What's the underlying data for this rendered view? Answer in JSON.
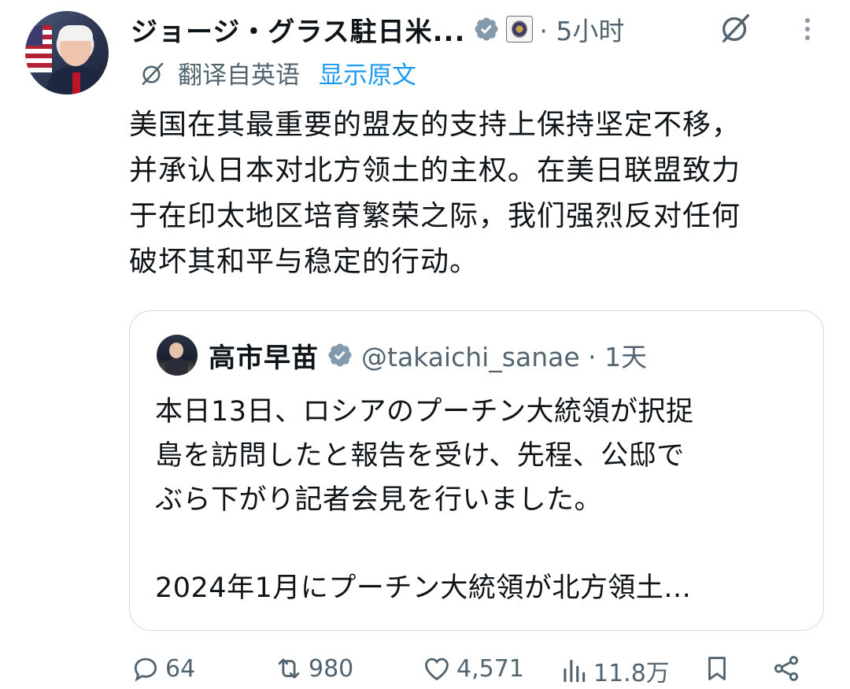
{
  "post": {
    "author_name": "ジョージ・グラス駐日米...",
    "time": "· 5小时",
    "translation": {
      "label": "翻译自英语",
      "show_original": "显示原文"
    },
    "text_lines": [
      "美国在其最重要的盟友的支持上保持坚定不移，",
      "并承认日本对北方领土的主权。在美日联盟致力",
      "于在印太地区培育繁荣之际，我们强烈反对任何",
      "破坏其和平与稳定的行动。"
    ]
  },
  "quoted": {
    "name": "高市早苗",
    "handle_time": "@takaichi_sanae · 1天",
    "text_lines": [
      "本日13日、ロシアのプーチン大統領が択捉",
      "島を訪問したと報告を受け、先程、公邸で",
      "ぶら下がり記者会見を行いました。",
      "",
      "2024年1月にプーチン大統領が北方領土..."
    ]
  },
  "actions": {
    "replies": "64",
    "reposts": "980",
    "likes": "4,571",
    "views": "11.8万"
  },
  "colors": {
    "accent": "#1d9bf0",
    "muted_text": "#536471",
    "verified_badge": "#829aab",
    "border": "#cfd9de"
  },
  "icons": [
    "verified-badge-icon",
    "org-affiliation-icon",
    "grok-icon",
    "more-icon",
    "translate-icon",
    "reply-icon",
    "repost-icon",
    "like-icon",
    "views-icon",
    "bookmark-icon",
    "share-icon"
  ]
}
